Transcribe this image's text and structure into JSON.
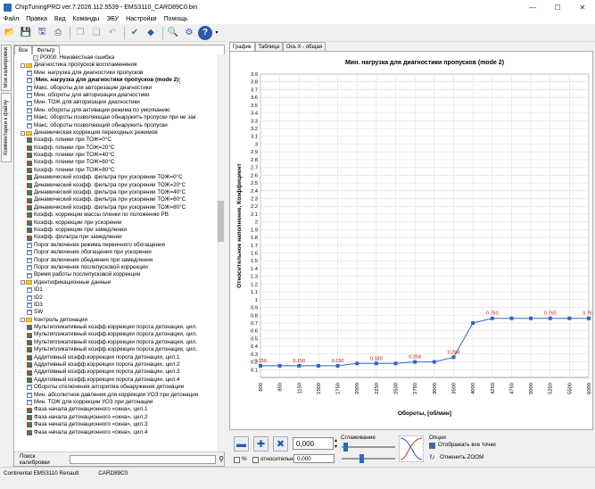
{
  "window": {
    "title": "ChipTuningPRO ver.7.2026.112.5539 - EMS3110_CARD89C0.bin",
    "minimize": "—",
    "maximize": "☐",
    "close": "✕"
  },
  "menu": [
    "Файл",
    "Правка",
    "Вид",
    "Команды",
    "ЭБУ",
    "Настройки",
    "Помощь"
  ],
  "sidetabs": {
    "maps": "Мои калибровки",
    "comments": "Комментарии к файлу"
  },
  "lefttabs": [
    "Все",
    "Фильтр"
  ],
  "tree": [
    {
      "indent": 3,
      "icon": "doc",
      "label": "P0000: Неизвестная ошибка"
    },
    {
      "indent": 1,
      "icon": "folder",
      "label": "Диагностика пропусков воспламенения"
    },
    {
      "indent": 2,
      "icon": "tbl",
      "label": "Мин. нагрузка для диагностики пропусков"
    },
    {
      "indent": 2,
      "icon": "tbl",
      "label": "Мин. нагрузка для диагностики пропусков (mode 2)",
      "selected": true
    },
    {
      "indent": 2,
      "icon": "tbl",
      "label": "Макс. обороты для авторизации диагностики"
    },
    {
      "indent": 2,
      "icon": "tbl",
      "label": "Мин. обороты для авторизации диагностики"
    },
    {
      "indent": 2,
      "icon": "tbl",
      "label": "Мин. ТОЖ для авторизации диагностики"
    },
    {
      "indent": 2,
      "icon": "tbl",
      "label": "Мин. обороты для активации режима по умолчанию"
    },
    {
      "indent": 2,
      "icon": "tbl",
      "label": "Макс. обороты позволяющая обнаружить пропуски при не зак"
    },
    {
      "indent": 2,
      "icon": "tbl",
      "label": "Макс. обороты позволяющий обнаружить пропуски"
    },
    {
      "indent": 1,
      "icon": "folder",
      "label": "Динамическая коррекция переходных режимов"
    },
    {
      "indent": 2,
      "icon": "map3d",
      "label": "Коэфф. пленки при ТОЖ=0°C"
    },
    {
      "indent": 2,
      "icon": "map3d",
      "label": "Коэфф. пленки при ТОЖ=20°C"
    },
    {
      "indent": 2,
      "icon": "map3d",
      "label": "Коэфф. пленки при ТОЖ=40°C"
    },
    {
      "indent": 2,
      "icon": "map3d",
      "label": "Коэфф. пленки при ТОЖ=60°C"
    },
    {
      "indent": 2,
      "icon": "map3d",
      "label": "Коэфф. пленки при ТОЖ=80°C"
    },
    {
      "indent": 2,
      "icon": "map3d",
      "label": "Динамический коэфф. фильтра при ускорении ТОЖ=0°C"
    },
    {
      "indent": 2,
      "icon": "map3d",
      "label": "Динамический коэфф. фильтра при ускорении ТОЖ=20°C"
    },
    {
      "indent": 2,
      "icon": "map3d",
      "label": "Динамический коэфф. фильтра при ускорении ТОЖ=40°C"
    },
    {
      "indent": 2,
      "icon": "map3d",
      "label": "Динамический коэфф. фильтра при ускорении ТОЖ=60°C"
    },
    {
      "indent": 2,
      "icon": "map3d",
      "label": "Динамический коэфф. фильтра при ускорении ТОЖ=80°C"
    },
    {
      "indent": 2,
      "icon": "map3d",
      "label": "Коэфф. коррекции массы пленки по положению РВ"
    },
    {
      "indent": 2,
      "icon": "map3d",
      "label": "Коэфф. коррекции при ускорении"
    },
    {
      "indent": 2,
      "icon": "map3d",
      "label": "Коэфф. коррекции при замедлении"
    },
    {
      "indent": 2,
      "icon": "map3d",
      "label": "Коэфф. фильтра при замедлении"
    },
    {
      "indent": 2,
      "icon": "tbl",
      "label": "Порог включения режима первичного обогащения"
    },
    {
      "indent": 2,
      "icon": "tbl",
      "label": "Порог включения обогащения при ускорении"
    },
    {
      "indent": 2,
      "icon": "tbl",
      "label": "Порог включения обеднения при замедлении"
    },
    {
      "indent": 2,
      "icon": "tbl",
      "label": "Порог включения послепусковой коррекции"
    },
    {
      "indent": 2,
      "icon": "tbl",
      "label": "Время работы послепусковой коррекции"
    },
    {
      "indent": 1,
      "icon": "folder",
      "label": "Идентификационные данные"
    },
    {
      "indent": 2,
      "icon": "tbl",
      "label": "ID1"
    },
    {
      "indent": 2,
      "icon": "tbl",
      "label": "ID2"
    },
    {
      "indent": 2,
      "icon": "tbl",
      "label": "ID3"
    },
    {
      "indent": 2,
      "icon": "tbl",
      "label": "SW"
    },
    {
      "indent": 1,
      "icon": "folder",
      "label": "Контроль детонации"
    },
    {
      "indent": 2,
      "icon": "map3d",
      "label": "Мультипликативный коэфф.коррекции порога детонации, цил."
    },
    {
      "indent": 2,
      "icon": "map3d",
      "label": "Мультипликативный коэфф.коррекции порога детонации, цил."
    },
    {
      "indent": 2,
      "icon": "map3d",
      "label": "Мультипликативный коэфф.коррекции порога детонации, цил."
    },
    {
      "indent": 2,
      "icon": "map3d",
      "label": "Мультипликативный коэфф.коррекции порога детонации, цил."
    },
    {
      "indent": 2,
      "icon": "map3d",
      "label": "Аддитивный коэфф.коррекции порога детонации, цил.1"
    },
    {
      "indent": 2,
      "icon": "map3d",
      "label": "Аддитивный коэфф.коррекции порога детонации, цил.2"
    },
    {
      "indent": 2,
      "icon": "map3d",
      "label": "Аддитивный коэфф.коррекции порога детонации, цил.3"
    },
    {
      "indent": 2,
      "icon": "map3d",
      "label": "Аддитивный коэфф.коррекции порога детонации, цил.4"
    },
    {
      "indent": 2,
      "icon": "tbl",
      "label": "Обороты отключения алгоритма обнаружения детонации"
    },
    {
      "indent": 2,
      "icon": "tbl",
      "label": "Мин. абсолютное давления для коррекции УОЗ при детонации"
    },
    {
      "indent": 2,
      "icon": "tbl",
      "label": "Мин. ТОЖ для коррекции УОЗ при детонации"
    },
    {
      "indent": 2,
      "icon": "map3d",
      "label": "Фаза начала детонационного «окна», цил.1"
    },
    {
      "indent": 2,
      "icon": "map3d",
      "label": "Фаза начала детонационного «окна», цил.2"
    },
    {
      "indent": 2,
      "icon": "map3d",
      "label": "Фаза начала детонационного «окна», цил.3"
    },
    {
      "indent": 2,
      "icon": "map3d",
      "label": "Фаза начала детонационного «окна», цил.4"
    }
  ],
  "search": {
    "label": "Поиск калибровки",
    "value": ""
  },
  "righttabs": [
    "График",
    "Таблица",
    "Ось X - общая"
  ],
  "chart_data": {
    "type": "line",
    "title": "Мин. нагрузка для диагностики пропусков (mode 2)",
    "xlabel": "Обороты, [об/мин]",
    "ylabel": "Относительное наполнение, Коэффициент",
    "x": [
      600,
      850,
      1150,
      1500,
      1750,
      2000,
      2250,
      2500,
      2750,
      3000,
      3500,
      4000,
      4250,
      4750,
      5000,
      5250,
      5500,
      6000
    ],
    "values": [
      0.15,
      0.15,
      0.15,
      0.15,
      0.15,
      0.18,
      0.18,
      0.18,
      0.2,
      0.2,
      0.26,
      0.7,
      0.76,
      0.76,
      0.76,
      0.76,
      0.76,
      0.76
    ],
    "data_labels": [
      {
        "index": 0,
        "text": "0.150"
      },
      {
        "index": 2,
        "text": "0.150"
      },
      {
        "index": 4,
        "text": "0.150"
      },
      {
        "index": 6,
        "text": "0.180"
      },
      {
        "index": 8,
        "text": "0.204"
      },
      {
        "index": 10,
        "text": "0.264"
      },
      {
        "index": 12,
        "text": "0.760"
      },
      {
        "index": 15,
        "text": "0.760"
      },
      {
        "index": 17,
        "text": "0.760"
      }
    ],
    "ylim": [
      0,
      3.9
    ],
    "yticks": [
      0.1,
      0.2,
      0.3,
      0.4,
      0.5,
      0.6,
      0.7,
      0.8,
      0.9,
      1,
      1.1,
      1.2,
      1.3,
      1.4,
      1.5,
      1.6,
      1.7,
      1.8,
      1.9,
      2,
      2.1,
      2.2,
      2.3,
      2.4,
      2.5,
      2.6,
      2.7,
      2.8,
      2.9,
      3,
      3.1,
      3.2,
      3.3,
      3.4,
      3.5,
      3.6,
      3.7,
      3.8,
      3.9
    ],
    "grid": true,
    "colors": {
      "line": "#2f67c6",
      "label": "#c01818",
      "grid": "#e0e0e0"
    }
  },
  "bottom": {
    "value1": "0,000",
    "value2": "0,000",
    "pct_label": "%",
    "relative_label": "относительно",
    "smoothing_label": "Сглаживание",
    "options_label": "Опции",
    "show_all_points": "Отображать все точки",
    "cancel_zoom": "Отменить ZOOM"
  },
  "status": {
    "left": "Continental EMS3110 Renault",
    "right": "CARD89C0"
  }
}
